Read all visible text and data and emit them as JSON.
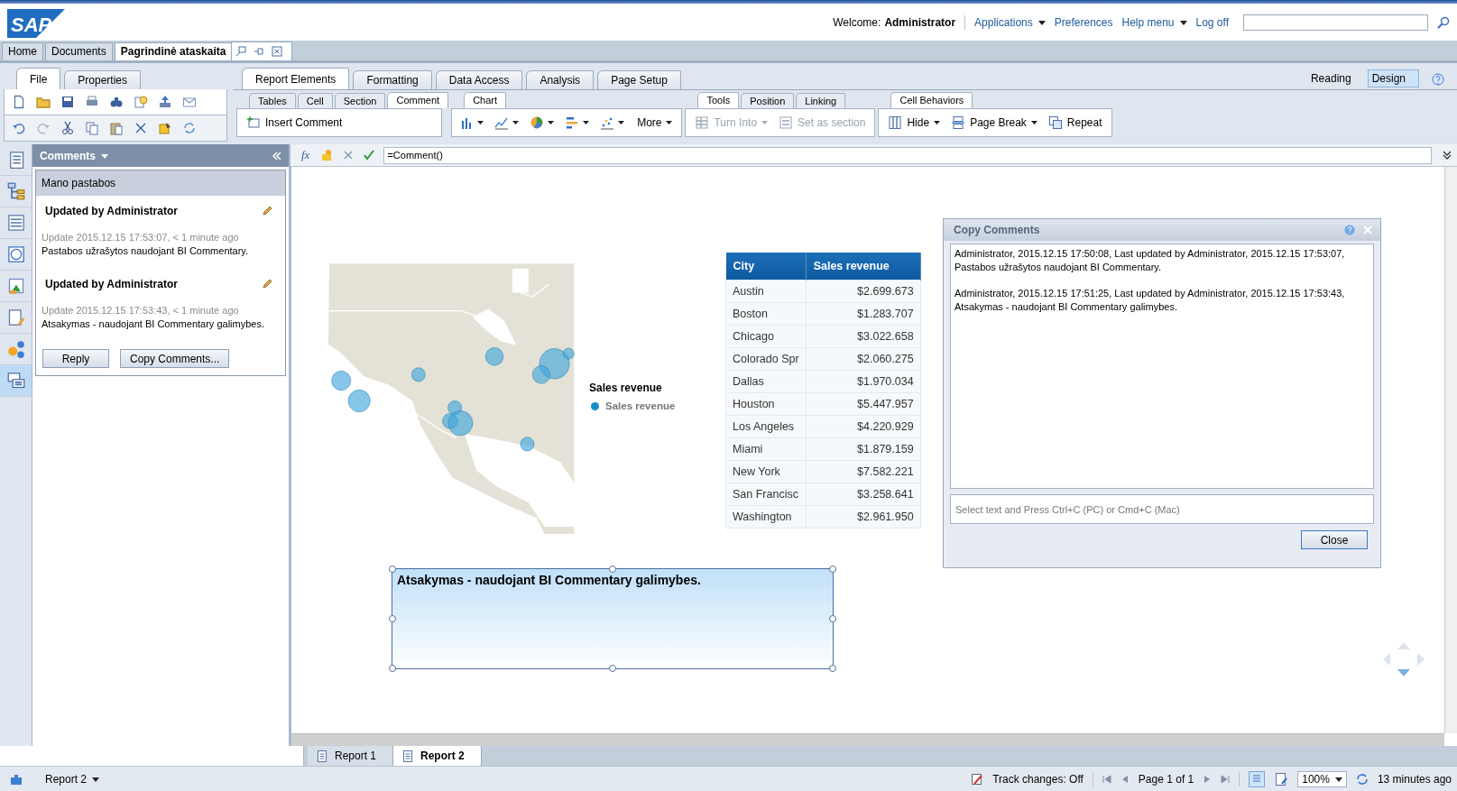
{
  "header": {
    "logo": "SAP",
    "welcome_label": "Welcome:",
    "user": "Administrator",
    "links": [
      {
        "label": "Applications",
        "dropdown": true
      },
      {
        "label": "Preferences",
        "dropdown": false
      },
      {
        "label": "Help menu",
        "dropdown": true
      },
      {
        "label": "Log off",
        "dropdown": false
      }
    ]
  },
  "doc_tabs": [
    {
      "label": "Home",
      "selected": false
    },
    {
      "label": "Documents",
      "selected": false
    },
    {
      "label": "Pagrindinė ataskaita",
      "selected": true
    }
  ],
  "left_tabs": [
    {
      "label": "File",
      "selected": true
    },
    {
      "label": "Properties",
      "selected": false
    }
  ],
  "ribbon_tabs": [
    {
      "label": "Report Elements",
      "selected": true
    },
    {
      "label": "Formatting",
      "selected": false
    },
    {
      "label": "Data Access",
      "selected": false
    },
    {
      "label": "Analysis",
      "selected": false
    },
    {
      "label": "Page Setup",
      "selected": false
    }
  ],
  "view_modes": [
    {
      "label": "Reading",
      "selected": false
    },
    {
      "label": "Design",
      "selected": true
    }
  ],
  "ribbon_groups": [
    {
      "kind": "comment",
      "tabs": [
        {
          "label": "Tables",
          "selected": false
        },
        {
          "label": "Cell",
          "selected": false
        },
        {
          "label": "Section",
          "selected": false
        },
        {
          "label": "Comment",
          "selected": true
        }
      ],
      "tools": [
        {
          "label": "Insert Comment",
          "dropdown": false,
          "disabled": false
        }
      ]
    },
    {
      "kind": "chart",
      "tabs": [
        {
          "label": "Chart",
          "selected": true
        }
      ],
      "tools": [
        {
          "label": "More",
          "dropdown": true,
          "disabled": false
        }
      ]
    },
    {
      "kind": "tools",
      "tabs": [
        {
          "label": "Tools",
          "selected": true
        },
        {
          "label": "Position",
          "selected": false
        },
        {
          "label": "Linking",
          "selected": false
        }
      ],
      "tools": [
        {
          "label": "Turn Into",
          "dropdown": true,
          "disabled": true
        },
        {
          "label": "Set as section",
          "dropdown": false,
          "disabled": true
        }
      ]
    },
    {
      "kind": "behaviors",
      "tabs": [
        {
          "label": "Cell Behaviors",
          "selected": true
        }
      ],
      "tools": [
        {
          "label": "Hide",
          "dropdown": true,
          "disabled": false
        },
        {
          "label": "Page Break",
          "dropdown": true,
          "disabled": false
        },
        {
          "label": "Repeat",
          "dropdown": false,
          "disabled": false
        }
      ]
    }
  ],
  "formula": {
    "label": "fx",
    "value": "=Comment()"
  },
  "side_strip": [
    {
      "selected": false
    },
    {
      "selected": false
    },
    {
      "selected": false
    },
    {
      "selected": false
    },
    {
      "selected": false
    },
    {
      "selected": false
    },
    {
      "selected": false
    },
    {
      "selected": true
    }
  ],
  "comments_panel": {
    "title": "Comments",
    "section": "Mano pastabos",
    "comments": [
      {
        "author": "Updated by Administrator",
        "meta": "Update 2015.12.15 17:53:07, < 1 minute ago",
        "text": "Pastabos užrašytos naudojant BI Commentary."
      },
      {
        "author": "Updated by Administrator",
        "meta": "Update 2015.12.15 17:53:43, < 1 minute ago",
        "text": "Atsakymas - naudojant BI Commentary galimybes."
      }
    ],
    "buttons": [
      "Reply",
      "Copy Comments..."
    ]
  },
  "legend": {
    "title": "Sales revenue",
    "items": [
      {
        "label": "Sales revenue",
        "color": "#1a8bcc"
      }
    ]
  },
  "table": {
    "columns": [
      "City",
      "Sales revenue"
    ],
    "rows": [
      [
        "Austin",
        "$2.699.673"
      ],
      [
        "Boston",
        "$1.283.707"
      ],
      [
        "Chicago",
        "$3.022.658"
      ],
      [
        "Colorado Spr",
        "$2.060.275"
      ],
      [
        "Dallas",
        "$1.970.034"
      ],
      [
        "Houston",
        "$5.447.957"
      ],
      [
        "Los Angeles",
        "$4.220.929"
      ],
      [
        "Miami",
        "$1.879.159"
      ],
      [
        "New York",
        "$7.582.221"
      ],
      [
        "San Francisc",
        "$3.258.641"
      ],
      [
        "Washington",
        "$2.961.950"
      ]
    ]
  },
  "comment_box": {
    "text": "Atsakymas - naudojant BI Commentary galimybes.",
    "selected": true
  },
  "dialog": {
    "title": "Copy Comments",
    "paragraphs": [
      [
        "Administrator, 2015.12.15 17:50:08, Last updated by Administrator, 2015.12.15 17:53:07,",
        "Pastabos užrašytos naudojant BI Commentary."
      ],
      [
        "Administrator, 2015.12.15 17:51:25, Last updated by Administrator, 2015.12.15 17:53:43,",
        "Atsakymas - naudojant BI Commentary galimybes."
      ]
    ],
    "placeholder": "Select text and Press Ctrl+C (PC) or Cmd+C (Mac)",
    "button": "Close"
  },
  "report_tabs": [
    {
      "label": "Report 1",
      "selected": false
    },
    {
      "label": "Report 2",
      "selected": true
    }
  ],
  "status_bar": {
    "report": "Report 2",
    "track_changes": "Track changes: Off",
    "page": "Page 1 of 1",
    "zoom": "100%",
    "refreshed": "13 minutes ago"
  }
}
